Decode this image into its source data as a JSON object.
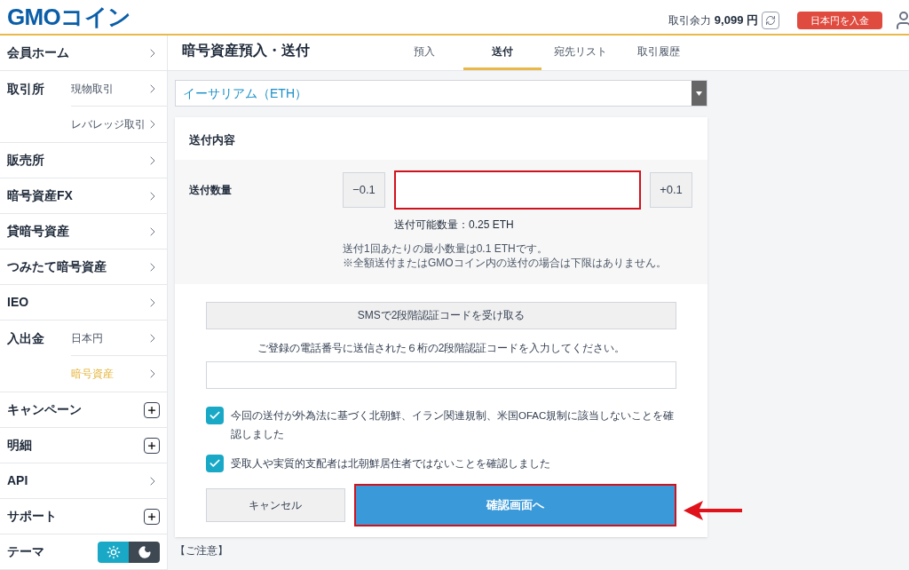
{
  "header": {
    "logo": "GMOコイン",
    "balance_label": "取引余力",
    "balance_value": "9,099 円",
    "deposit_button": "日本円を入金"
  },
  "sidebar": {
    "items": [
      {
        "label": "会員ホーム",
        "kind": "chevron"
      },
      {
        "label": "取引所",
        "children": [
          {
            "label": "現物取引",
            "selected": false
          },
          {
            "label": "レバレッジ取引",
            "selected": false
          }
        ]
      },
      {
        "label": "販売所",
        "kind": "chevron"
      },
      {
        "label": "暗号資産FX",
        "kind": "chevron"
      },
      {
        "label": "貸暗号資産",
        "kind": "chevron"
      },
      {
        "label": "つみたて暗号資産",
        "kind": "chevron"
      },
      {
        "label": "IEO",
        "kind": "chevron"
      },
      {
        "label": "入出金",
        "children": [
          {
            "label": "日本円",
            "selected": false
          },
          {
            "label": "暗号資産",
            "selected": true
          }
        ]
      },
      {
        "label": "キャンペーン",
        "kind": "plus"
      },
      {
        "label": "明細",
        "kind": "plus"
      },
      {
        "label": "API",
        "kind": "chevron"
      },
      {
        "label": "サポート",
        "kind": "plus"
      },
      {
        "label": "テーマ",
        "kind": "theme"
      }
    ],
    "theme_toggle": [
      {
        "kind": "light",
        "selected": true
      },
      {
        "kind": "dark",
        "selected": false
      }
    ]
  },
  "page": {
    "title": "暗号資産預入・送付",
    "tabs": [
      {
        "label": "預入",
        "selected": false
      },
      {
        "label": "送付",
        "selected": true
      },
      {
        "label": "宛先リスト",
        "selected": false
      },
      {
        "label": "取引履歴",
        "selected": false
      }
    ],
    "asset_select": "イーサリアム（ETH）",
    "form": {
      "section_title": "送付内容",
      "amount_label": "送付数量",
      "minus_button": "−0.1",
      "plus_button": "+0.1",
      "available": "送付可能数量：0.25 ETH",
      "notes": [
        "送付1回あたりの最小数量は0.1 ETHです。",
        "※全額送付またはGMOコイン内の送付の場合は下限はありません。"
      ],
      "sms_button": "SMSで2段階認証コードを受け取る",
      "code_prompt": "ご登録の電話番号に送信された６桁の2段階認証コードを入力してください。",
      "confirmations": [
        {
          "text": "今回の送付が外為法に基づく北朝鮮、イラン関連規制、米国OFAC規制に該当しないことを確認しました",
          "checked": true
        },
        {
          "text": "受取人や実質的支配者は北朝鮮居住者ではないことを確認しました",
          "checked": true
        }
      ],
      "cancel_button": "キャンセル",
      "confirm_button": "確認画面へ"
    },
    "notice_heading": "【ご注意】"
  }
}
